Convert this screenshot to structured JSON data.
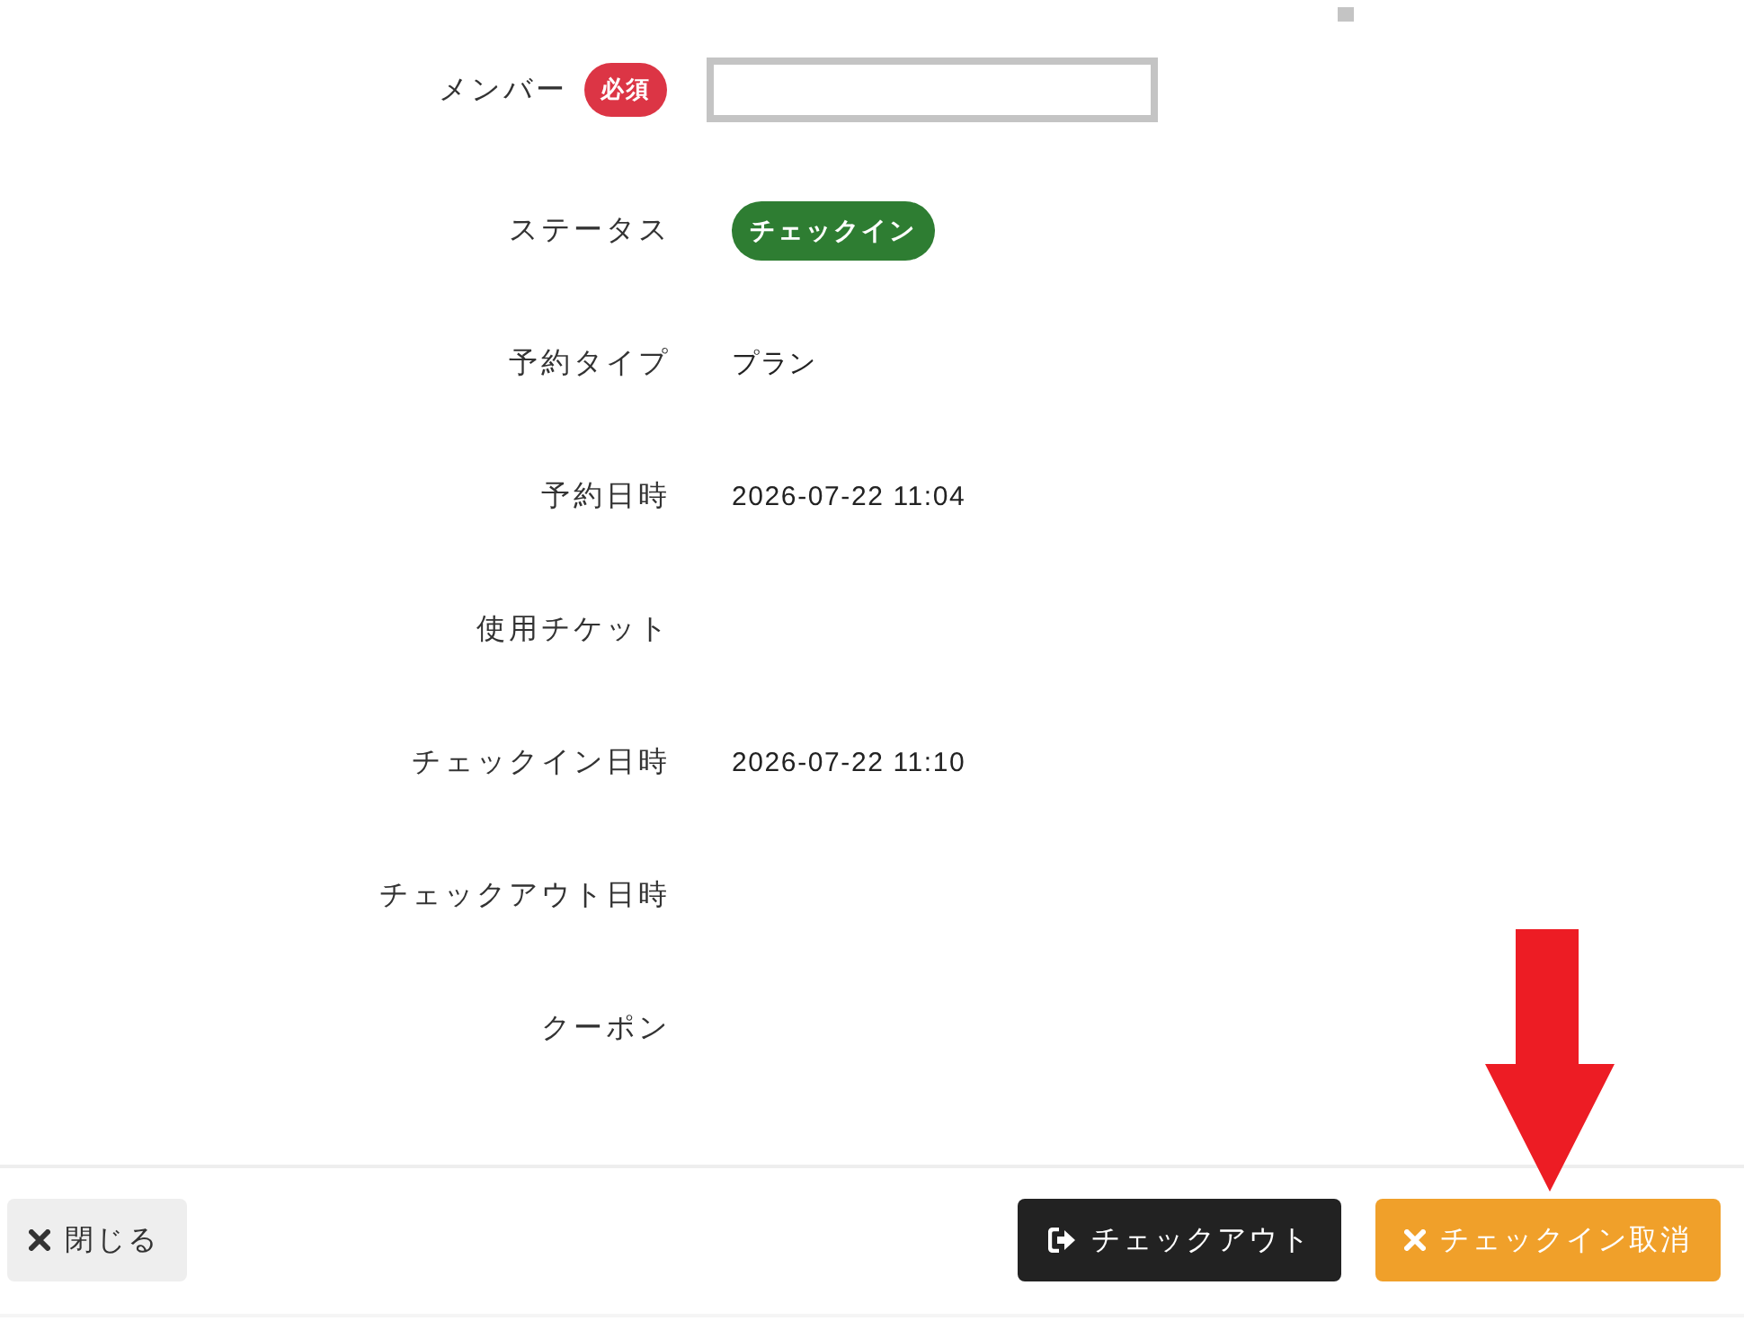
{
  "form": {
    "fields": [
      {
        "label": "メンバー",
        "required_badge": "必須",
        "kind": "input"
      },
      {
        "label": "ステータス",
        "kind": "status",
        "value": "チェックイン"
      },
      {
        "label": "予約タイプ",
        "kind": "text",
        "value": "プラン"
      },
      {
        "label": "予約日時",
        "kind": "text",
        "value": "2026-07-22 11:04"
      },
      {
        "label": "使用チケット",
        "kind": "text"
      },
      {
        "label": "チェックイン日時",
        "kind": "text",
        "value": "2026-07-22 11:10"
      },
      {
        "label": "チェックアウト日時",
        "kind": "text"
      },
      {
        "label": "クーポン",
        "kind": "text"
      }
    ]
  },
  "footer": {
    "left_buttons": [
      {
        "label": "閉じる",
        "kind": "close"
      }
    ],
    "right_buttons": [
      {
        "label": "チェックアウト",
        "kind": "checkout"
      },
      {
        "label": "チェックイン取消",
        "kind": "cancel"
      }
    ]
  }
}
